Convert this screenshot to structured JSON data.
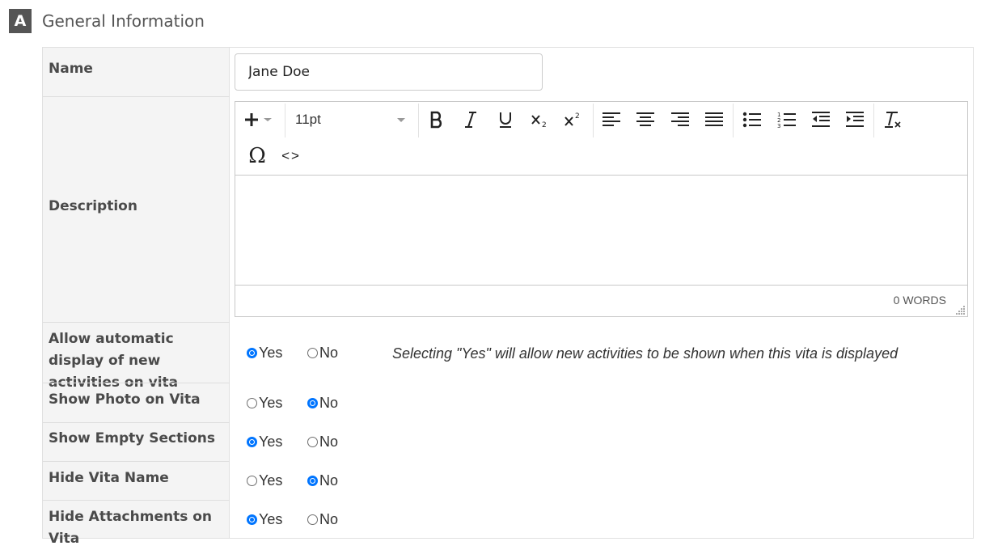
{
  "section": {
    "badge": "A",
    "title": "General Information"
  },
  "fields": {
    "name": {
      "label": "Name",
      "value": "Jane Doe"
    },
    "description": {
      "label": "Description",
      "toolbar": {
        "font_size": "11pt",
        "special_char_glyph": "Ω",
        "source_code_glyph": "<>",
        "icons": [
          "insert-plus-icon",
          "bold-icon",
          "italic-icon",
          "underline-icon",
          "subscript-icon",
          "superscript-icon",
          "align-left-icon",
          "align-center-icon",
          "align-right-icon",
          "align-justify-icon",
          "bullet-list-icon",
          "numbered-list-icon",
          "outdent-icon",
          "indent-icon",
          "clear-formatting-icon",
          "special-character-icon",
          "source-code-icon"
        ]
      },
      "word_count": "0 WORDS"
    }
  },
  "radio_rows": [
    {
      "label": "Allow automatic display of new activities on vita",
      "yes": "Yes",
      "no": "No",
      "selected": "yes",
      "hint": "Selecting \"Yes\" will allow new activities to be shown when this vita is displayed"
    },
    {
      "label": "Show Photo on Vita",
      "yes": "Yes",
      "no": "No",
      "selected": "no"
    },
    {
      "label": "Show Empty Sections",
      "yes": "Yes",
      "no": "No",
      "selected": "yes"
    },
    {
      "label": "Hide Vita Name",
      "yes": "Yes",
      "no": "No",
      "selected": "no"
    },
    {
      "label": "Hide Attachments on Vita",
      "yes": "Yes",
      "no": "No",
      "selected": "yes"
    }
  ],
  "colors": {
    "accent": "#0075ff",
    "badge_bg": "#555555",
    "label_bg": "#f4f4f4"
  }
}
